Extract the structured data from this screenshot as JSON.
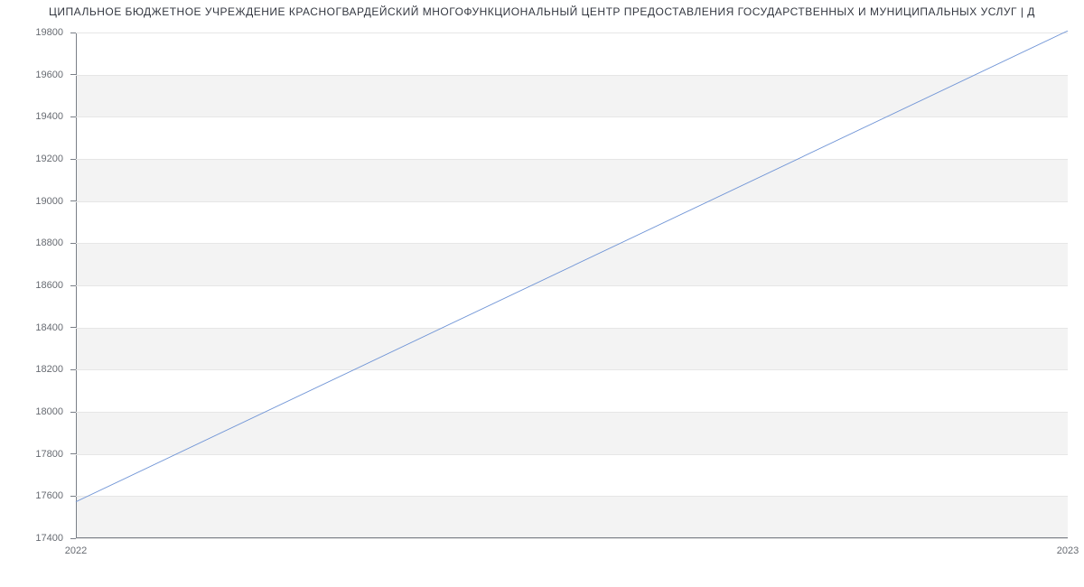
{
  "chart_data": {
    "type": "line",
    "title": "ЦИПАЛЬНОЕ БЮДЖЕТНОЕ УЧРЕЖДЕНИЕ КРАСНОГВАРДЕЙСКИЙ МНОГОФУНКЦИОНАЛЬНЫЙ ЦЕНТР ПРЕДОСТАВЛЕНИЯ ГОСУДАРСТВЕННЫХ И МУНИЦИПАЛЬНЫХ УСЛУГ | Д",
    "x": [
      2022,
      2023
    ],
    "values": [
      17573,
      19808
    ],
    "xlabel": "",
    "ylabel": "",
    "xlim": [
      2022,
      2023
    ],
    "ylim": [
      17400,
      19800
    ],
    "y_ticks": [
      17400,
      17600,
      17800,
      18000,
      18200,
      18400,
      18600,
      18800,
      19000,
      19200,
      19400,
      19600,
      19800
    ],
    "x_ticks": [
      2022,
      2023
    ],
    "grid": true
  }
}
